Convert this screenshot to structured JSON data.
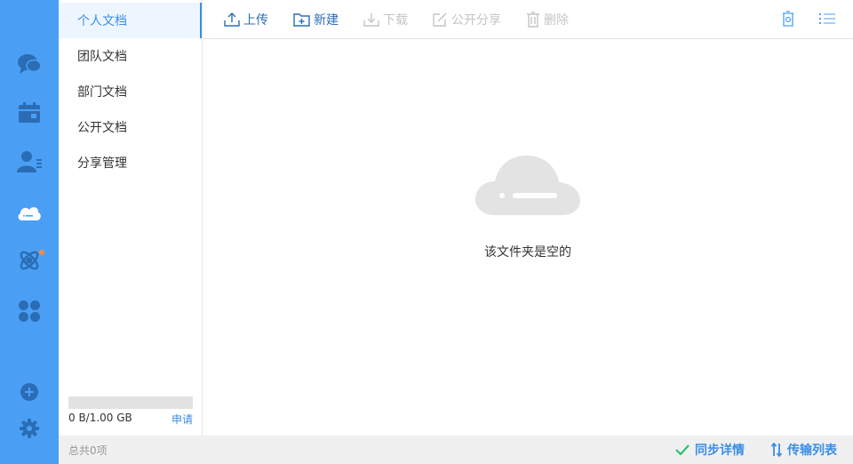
{
  "rail": {
    "items": [
      {
        "icon": "chat-icon"
      },
      {
        "icon": "calendar-icon"
      },
      {
        "icon": "contacts-icon"
      },
      {
        "icon": "cloud-drive-icon",
        "active": true
      },
      {
        "icon": "atom-icon",
        "badge": true
      },
      {
        "icon": "apps-icon"
      },
      {
        "icon": "add-circle-icon"
      },
      {
        "icon": "gear-icon"
      }
    ],
    "colors": {
      "background": "#4a9ff5",
      "badge": "#ff8a3d"
    }
  },
  "nav": {
    "items": [
      {
        "label": "个人文档",
        "active": true
      },
      {
        "label": "团队文档"
      },
      {
        "label": "部门文档"
      },
      {
        "label": "公开文档"
      },
      {
        "label": "分享管理"
      }
    ]
  },
  "quota": {
    "text": "0 B/1.00 GB",
    "apply_label": "申请",
    "used_fraction": 0
  },
  "toolbar": {
    "upload_label": "上传",
    "new_label": "新建",
    "download_label": "下载",
    "public_share_label": "公开分享",
    "delete_label": "删除",
    "right_icons": [
      "recycle-bin-icon",
      "list-view-icon"
    ]
  },
  "main": {
    "empty_text": "该文件夹是空的"
  },
  "status": {
    "count_text": "总共0项",
    "sync_label": "同步详情",
    "transfer_label": "传输列表"
  }
}
